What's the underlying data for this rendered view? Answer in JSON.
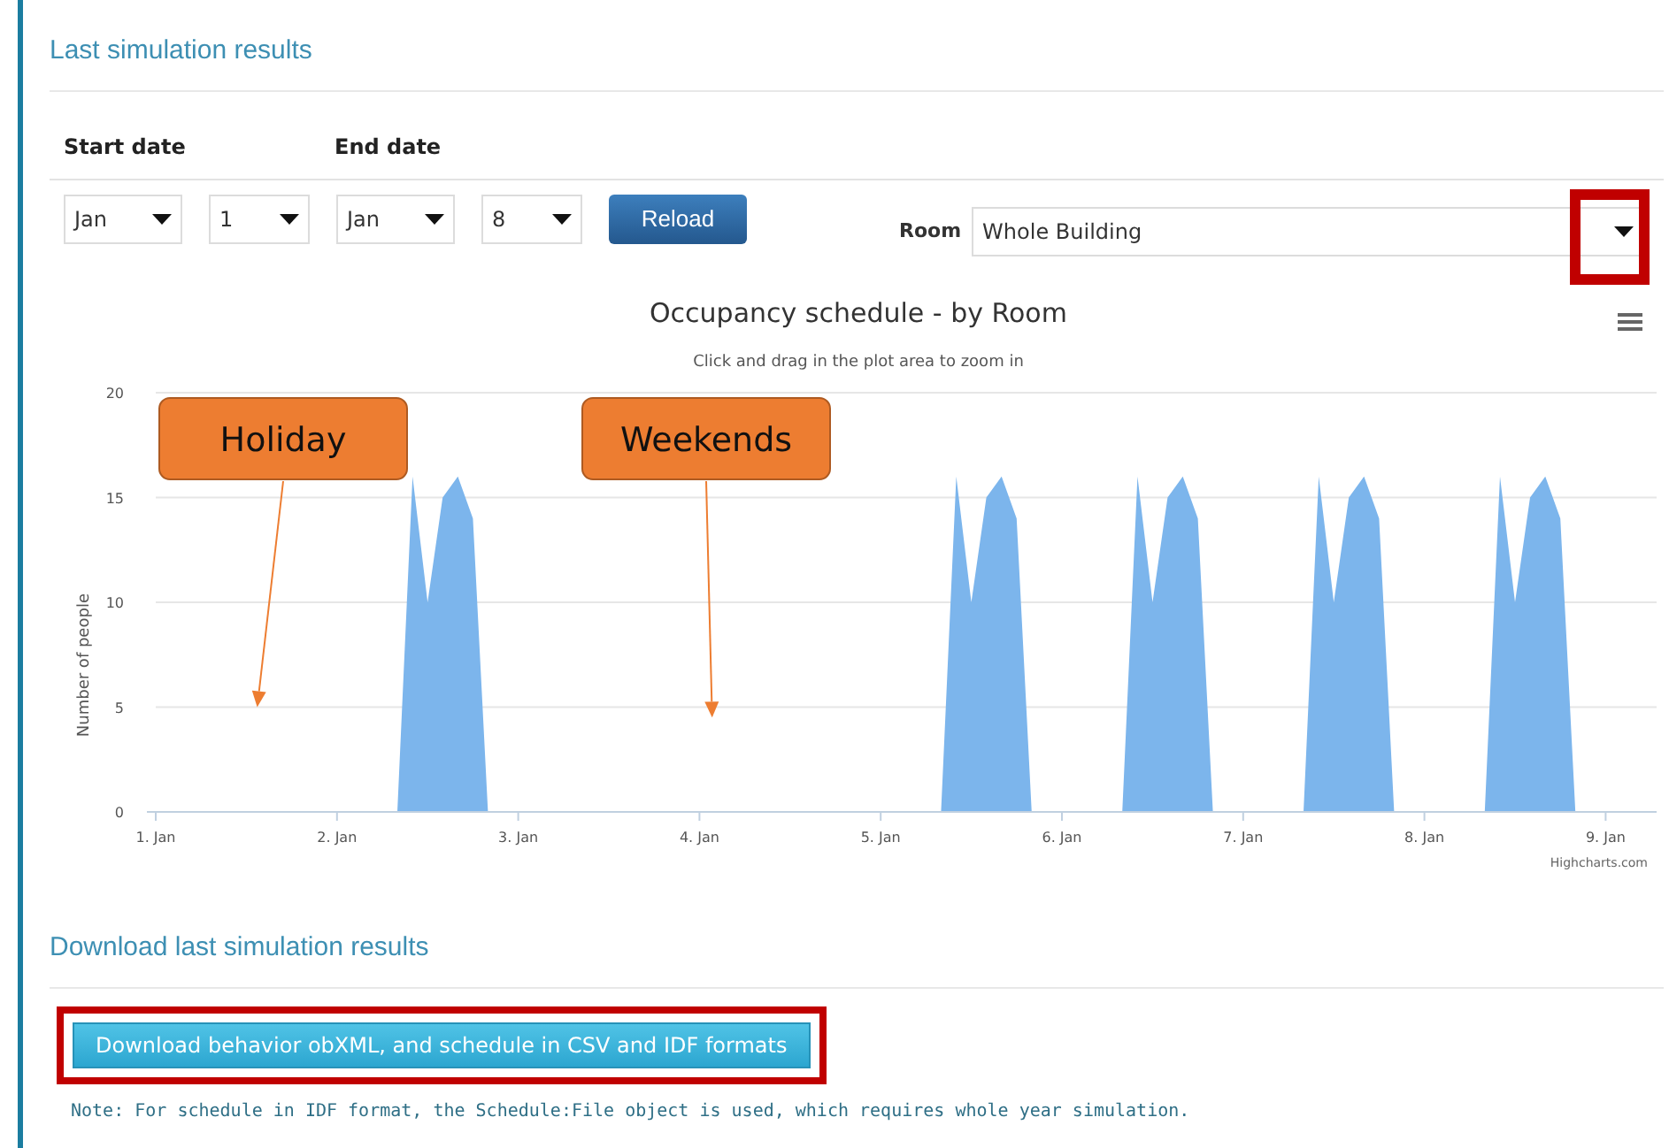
{
  "section_title": "Last simulation results",
  "date_range": {
    "start_label": "Start date",
    "end_label": "End date",
    "start_month": "Jan",
    "start_day": "1",
    "end_month": "Jan",
    "end_day": "8",
    "reload_button": "Reload"
  },
  "room": {
    "label": "Room",
    "value": "Whole Building",
    "highlighted": true
  },
  "chart": {
    "subtitle": "Click and drag in the plot area to zoom in",
    "credit": "Highcharts.com",
    "chart_data": {
      "type": "area",
      "grid": true,
      "title": "Occupancy schedule - by Room",
      "ylabel": "Number of people",
      "ylim": [
        0,
        20
      ],
      "yticks": [
        0,
        5,
        10,
        15,
        20
      ],
      "categories": [
        "1. Jan",
        null,
        null,
        null,
        null,
        null,
        null,
        null,
        null,
        null,
        null,
        null,
        "2. Jan",
        null,
        null,
        null,
        null,
        null,
        null,
        null,
        null,
        null,
        null,
        null,
        "3. Jan",
        null,
        null,
        null,
        null,
        null,
        null,
        null,
        null,
        null,
        null,
        null,
        "4. Jan",
        null,
        null,
        null,
        null,
        null,
        null,
        null,
        null,
        null,
        null,
        null,
        "5. Jan",
        null,
        null,
        null,
        null,
        null,
        null,
        null,
        null,
        null,
        null,
        null,
        "6. Jan",
        null,
        null,
        null,
        null,
        null,
        null,
        null,
        null,
        null,
        null,
        null,
        "7. Jan",
        null,
        null,
        null,
        null,
        null,
        null,
        null,
        null,
        null,
        null,
        null,
        "8. Jan",
        null,
        null,
        null,
        null,
        null,
        null,
        null,
        null,
        null,
        null,
        null,
        "9. Jan"
      ],
      "series": [
        {
          "color": "#7cb5ec",
          "values": [
            0,
            0,
            0,
            0,
            0,
            0,
            0,
            0,
            0,
            0,
            0,
            0,
            0,
            0,
            0,
            0,
            0,
            16,
            10,
            15,
            16,
            14,
            0,
            0,
            0,
            0,
            0,
            0,
            0,
            0,
            0,
            0,
            0,
            0,
            0,
            0,
            0,
            0,
            0,
            0,
            0,
            0,
            0,
            0,
            0,
            0,
            0,
            0,
            0,
            0,
            0,
            0,
            0,
            16,
            10,
            15,
            16,
            14,
            0,
            0,
            0,
            0,
            0,
            0,
            0,
            16,
            10,
            15,
            16,
            14,
            0,
            0,
            0,
            0,
            0,
            0,
            0,
            16,
            10,
            15,
            16,
            14,
            0,
            0,
            0,
            0,
            0,
            0,
            0,
            16,
            10,
            15,
            16,
            14,
            0,
            0,
            0
          ]
        }
      ],
      "annotations": [
        "Holiday",
        "Weekends"
      ]
    }
  },
  "download": {
    "title": "Download last simulation results",
    "button": "Download behavior obXML, and schedule in CSV and IDF formats",
    "highlighted": true,
    "note": "Note: For schedule in IDF format, the Schedule:File object is used, which requires whole year simulation."
  }
}
